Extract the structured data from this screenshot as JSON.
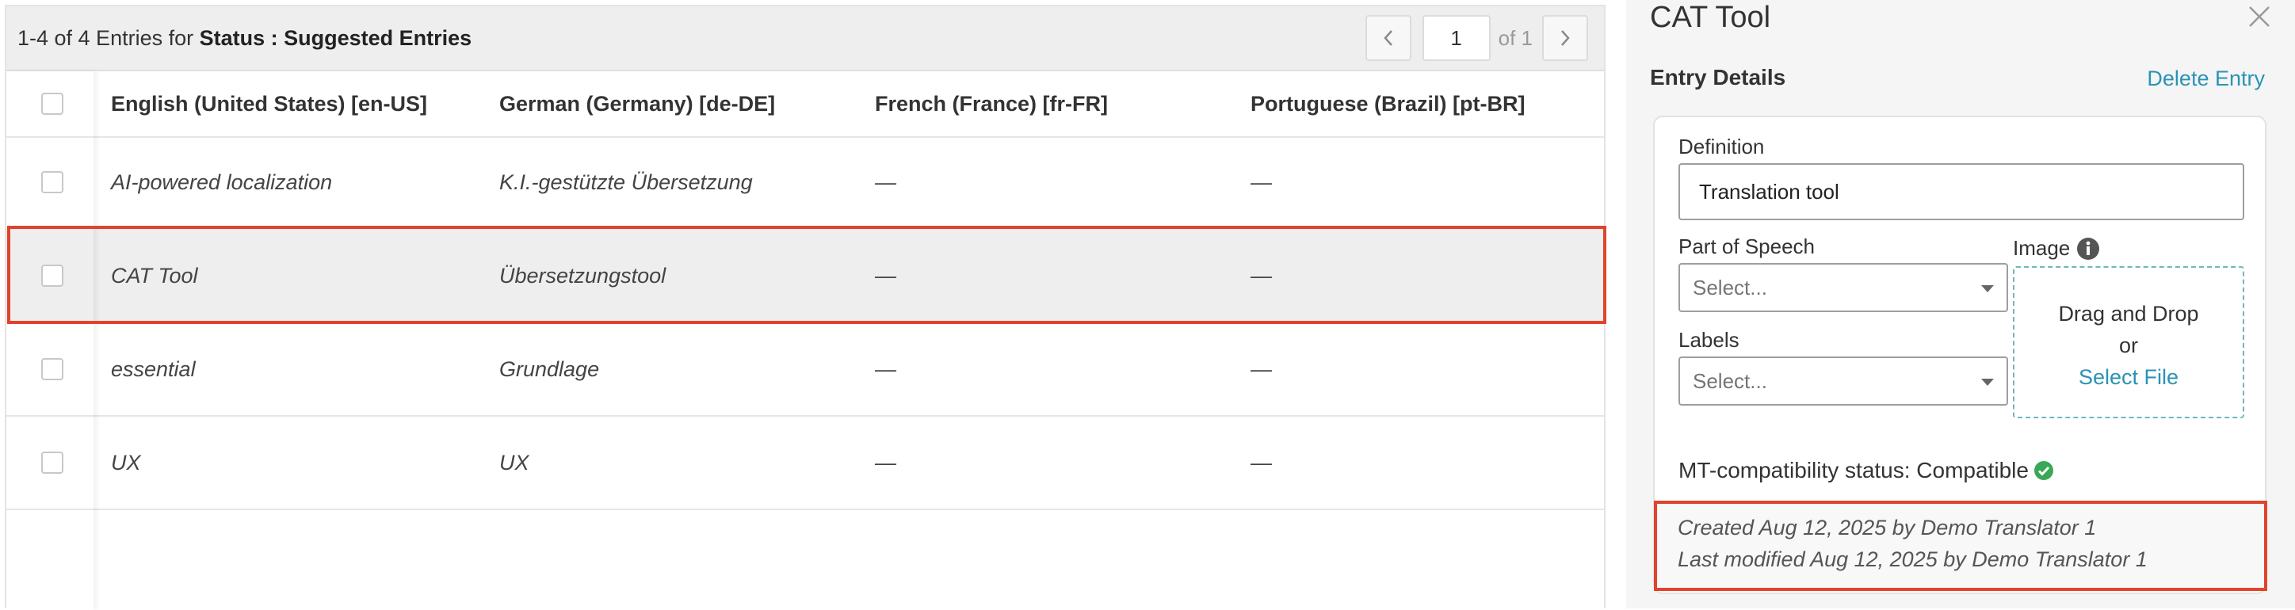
{
  "table": {
    "summary_prefix": "1-4 of 4 Entries for ",
    "status_label": "Status",
    "status_sep": " : ",
    "status_value": "Suggested Entries",
    "pager": {
      "page": "1",
      "of_label": "of 1"
    },
    "columns": [
      "English (United States) [en-US]",
      "German (Germany) [de-DE]",
      "French (France) [fr-FR]",
      "Portuguese (Brazil) [pt-BR]"
    ],
    "rows": [
      {
        "cells": [
          "AI-powered localization",
          "K.I.-gestützte Übersetzung",
          "—",
          "—"
        ]
      },
      {
        "cells": [
          "CAT Tool",
          "Übersetzungstool",
          "—",
          "—"
        ],
        "selected": true
      },
      {
        "cells": [
          "essential",
          "Grundlage",
          "—",
          "—"
        ]
      },
      {
        "cells": [
          "UX",
          "UX",
          "—",
          "—"
        ]
      }
    ]
  },
  "details": {
    "title": "CAT Tool",
    "section_title": "Entry Details",
    "delete_label": "Delete Entry",
    "definition_label": "Definition",
    "definition_value": "Translation tool",
    "part_of_speech_label": "Part of Speech",
    "part_of_speech_value": "Select...",
    "labels_label": "Labels",
    "labels_value": "Select...",
    "image_label": "Image",
    "dropzone_line1": "Drag and Drop",
    "dropzone_line2": "or",
    "dropzone_link": "Select File",
    "mt_status": "MT-compatibility status: Compatible",
    "created": "Created Aug 12, 2025 by Demo Translator 1",
    "modified": "Last modified Aug 12, 2025 by Demo Translator 1"
  },
  "colors": {
    "accent": "#2a93b4",
    "highlight": "#e0442c",
    "success": "#3aa757"
  },
  "icons": [
    "chevron-left-icon",
    "chevron-right-icon",
    "close-icon",
    "info-icon",
    "check-circle-icon"
  ]
}
